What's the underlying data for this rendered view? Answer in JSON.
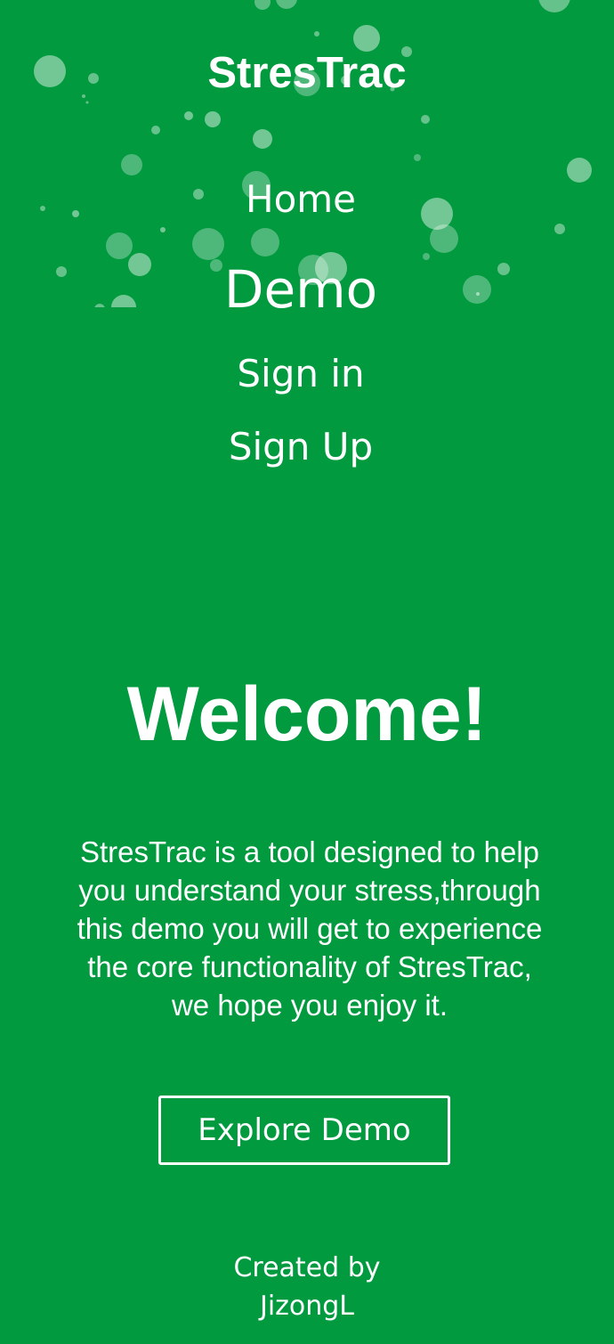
{
  "header": {
    "app_title": "StresTrac"
  },
  "nav": {
    "items": [
      {
        "label": "Home"
      },
      {
        "label": "Demo"
      },
      {
        "label": "Sign in"
      },
      {
        "label": "Sign Up"
      }
    ]
  },
  "hero": {
    "heading": "Welcome!",
    "description": "StresTrac is a tool designed to help you understand your stress,through this demo you will get to experience the core functionality of StresTrac, we hope you enjoy it.",
    "cta_label": "Explore Demo"
  },
  "footer": {
    "line1": "Created by",
    "line2": "JizongL"
  },
  "colors": {
    "background": "#019a3f",
    "text": "#ffffff",
    "bubble": "rgba(255,255,255,0.35)"
  }
}
